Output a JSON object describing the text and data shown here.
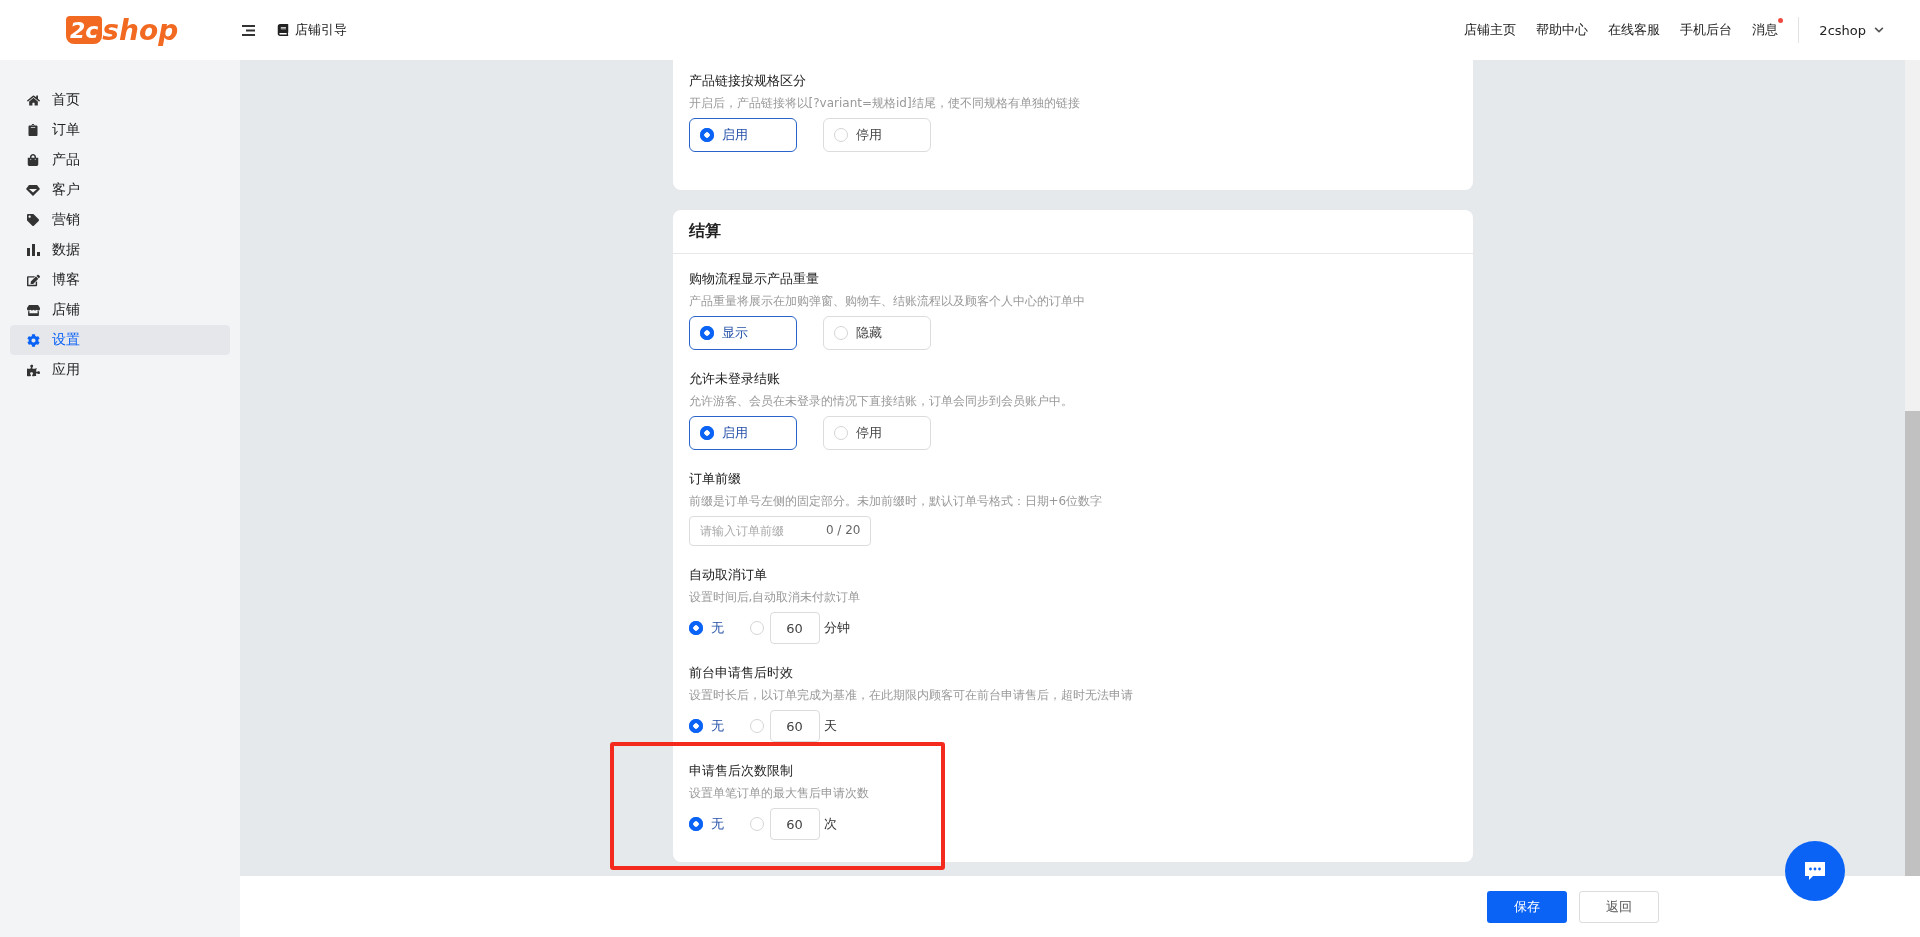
{
  "header": {
    "logo": {
      "badge": "2c",
      "text": "shop"
    },
    "guide": "店铺引导",
    "nav": [
      {
        "label": "店铺主页",
        "unread": false
      },
      {
        "label": "帮助中心",
        "unread": false
      },
      {
        "label": "在线客服",
        "unread": false
      },
      {
        "label": "手机后台",
        "unread": false
      },
      {
        "label": "消息",
        "unread": true
      }
    ],
    "account": "2cshop"
  },
  "sidebar": {
    "items": [
      {
        "label": "首页",
        "selected": false
      },
      {
        "label": "订单",
        "selected": false
      },
      {
        "label": "产品",
        "selected": false
      },
      {
        "label": "客户",
        "selected": false
      },
      {
        "label": "营销",
        "selected": false
      },
      {
        "label": "数据",
        "selected": false
      },
      {
        "label": "博客",
        "selected": false
      },
      {
        "label": "店铺",
        "selected": false
      },
      {
        "label": "设置",
        "selected": true
      },
      {
        "label": "应用",
        "selected": false
      }
    ]
  },
  "cards": [
    {
      "sections": [
        {
          "kind": "choice",
          "title": "产品链接按规格区分",
          "description": "开启后，产品链接将以[?variant=规格id]结尾，使不同规格有单独的链接",
          "options": [
            {
              "label": "启用",
              "selected": true
            },
            {
              "label": "停用",
              "selected": false
            }
          ]
        }
      ]
    },
    {
      "title": "结算",
      "sections": [
        {
          "kind": "choice",
          "title": "购物流程显示产品重量",
          "description": "产品重量将展示在加购弹窗、购物车、结账流程以及顾客个人中心的订单中",
          "options": [
            {
              "label": "显示",
              "selected": true
            },
            {
              "label": "隐藏",
              "selected": false
            }
          ]
        },
        {
          "kind": "choice",
          "title": "允许未登录结账",
          "description": "允许游客、会员在未登录的情况下直接结账，订单会同步到会员账户中。",
          "options": [
            {
              "label": "启用",
              "selected": true
            },
            {
              "label": "停用",
              "selected": false
            }
          ]
        },
        {
          "kind": "input",
          "title": "订单前缀",
          "description": "前缀是订单号左侧的固定部分。未加前缀时，默认订单号格式：日期+6位数字",
          "placeholder": "请输入订单前缀",
          "counter": "0 / 20"
        },
        {
          "kind": "limit",
          "title": "自动取消订单",
          "description": "设置时间后,自动取消未付款订单",
          "none": {
            "label": "无",
            "selected": true
          },
          "custom": {
            "selected": false,
            "value": "60",
            "unit": "分钟"
          }
        },
        {
          "kind": "limit",
          "title": "前台申请售后时效",
          "description": "设置时长后，以订单完成为基准，在此期限内顾客可在前台申请售后，超时无法申请",
          "none": {
            "label": "无",
            "selected": true
          },
          "custom": {
            "selected": false,
            "value": "60",
            "unit": "天"
          }
        },
        {
          "kind": "limit",
          "title": "申请售后次数限制",
          "description": "设置单笔订单的最大售后申请次数",
          "none": {
            "label": "无",
            "selected": true
          },
          "custom": {
            "selected": false,
            "value": "60",
            "unit": "次"
          },
          "highlighted": true
        }
      ]
    }
  ],
  "footer": {
    "buttons": [
      {
        "label": "保存",
        "kind": "primary"
      },
      {
        "label": "返回",
        "kind": "default"
      }
    ]
  }
}
